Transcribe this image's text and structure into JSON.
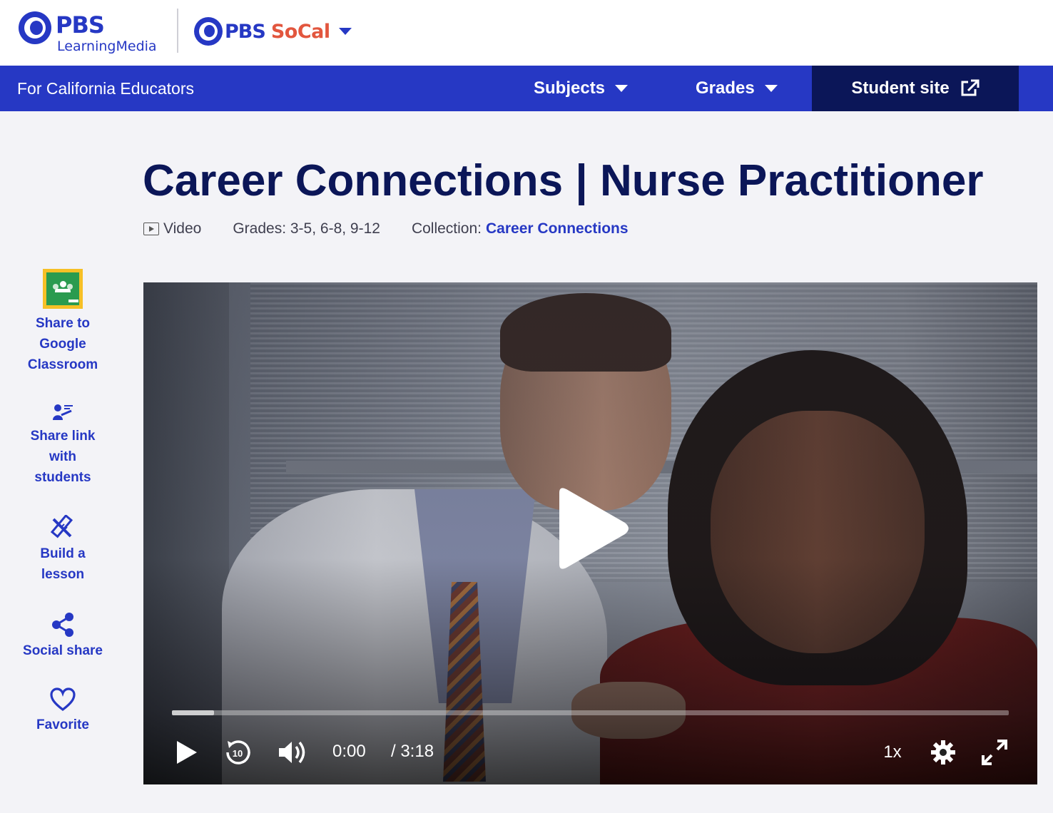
{
  "header": {
    "brand_main": "PBS",
    "brand_sub": "LearningMedia",
    "station_pbs": "PBS",
    "station_name": "SoCal"
  },
  "nav": {
    "audience": "For California Educators",
    "subjects": "Subjects",
    "grades": "Grades",
    "student_site": "Student site"
  },
  "resource": {
    "title": "Career Connections | Nurse Practitioner",
    "type": "Video",
    "grades": "Grades: 3-5, 6-8, 9-12",
    "collection_label": "Collection:",
    "collection_name": "Career Connections"
  },
  "sidebar": {
    "items": [
      {
        "label": "Share to Google Classroom",
        "icon": "google-classroom-icon"
      },
      {
        "label": "Share link with students",
        "icon": "share-link-icon"
      },
      {
        "label": "Build a lesson",
        "icon": "build-lesson-icon"
      },
      {
        "label": "Social share",
        "icon": "share-icon"
      },
      {
        "label": "Favorite",
        "icon": "heart-icon"
      }
    ]
  },
  "player": {
    "current_time": "0:00",
    "duration": "/ 3:18",
    "speed": "1x",
    "progress": 0.05
  },
  "colors": {
    "brand_blue": "#2638c4",
    "navy": "#0b1658",
    "socal_orange": "#e2563e"
  }
}
